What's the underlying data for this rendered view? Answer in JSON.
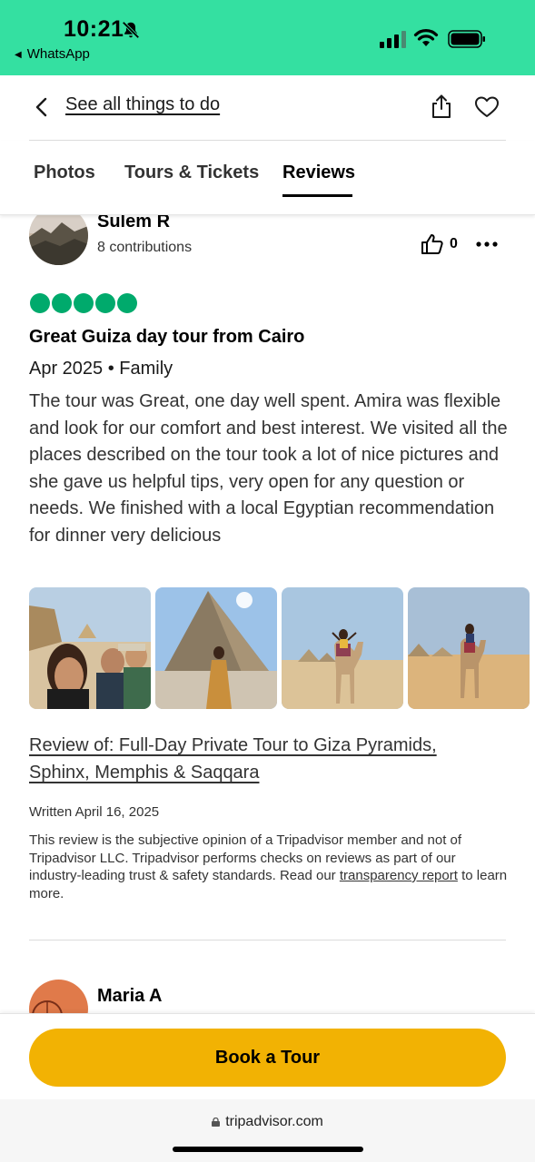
{
  "status_bar": {
    "time": "10:21",
    "back_app": "WhatsApp",
    "bg_color": "#34e0a1"
  },
  "nav": {
    "back_link": "See all things to do"
  },
  "tabs": [
    {
      "label": "Photos"
    },
    {
      "label": "Tours & Tickets"
    },
    {
      "label": "Reviews",
      "active": true
    }
  ],
  "review": {
    "user_name": "Sulem R",
    "contributions": "8 contributions",
    "helpful_count": "0",
    "rating": 5,
    "title": "Great Guiza day tour from Cairo",
    "meta": "Apr 2025 • Family",
    "body": "The tour was Great, one day well spent. Amira was flexible and look for our comfort and best interest. We visited all the places described on the tour took a lot of nice pictures and she gave us helpful tips, very open for any question or needs. We finished with a local Egyptian recommendation for dinner very delicious",
    "review_of": "Review of: Full-Day Private Tour to Giza Pyramids, Sphinx, Memphis & Saqqara",
    "written": "Written April 16, 2025",
    "disclaimer_text": "This review is the subjective opinion of a Tripadvisor member and not of Tripadvisor LLC. Tripadvisor performs checks on reviews as part of our industry-leading trust & safety standards. Read our ",
    "disclaimer_link": "transparency report",
    "disclaimer_end": " to learn more."
  },
  "next_review": {
    "user_name": "Maria A"
  },
  "cta": {
    "label": "Book a Tour",
    "color": "#f2b203"
  },
  "browser": {
    "url": "tripadvisor.com"
  }
}
